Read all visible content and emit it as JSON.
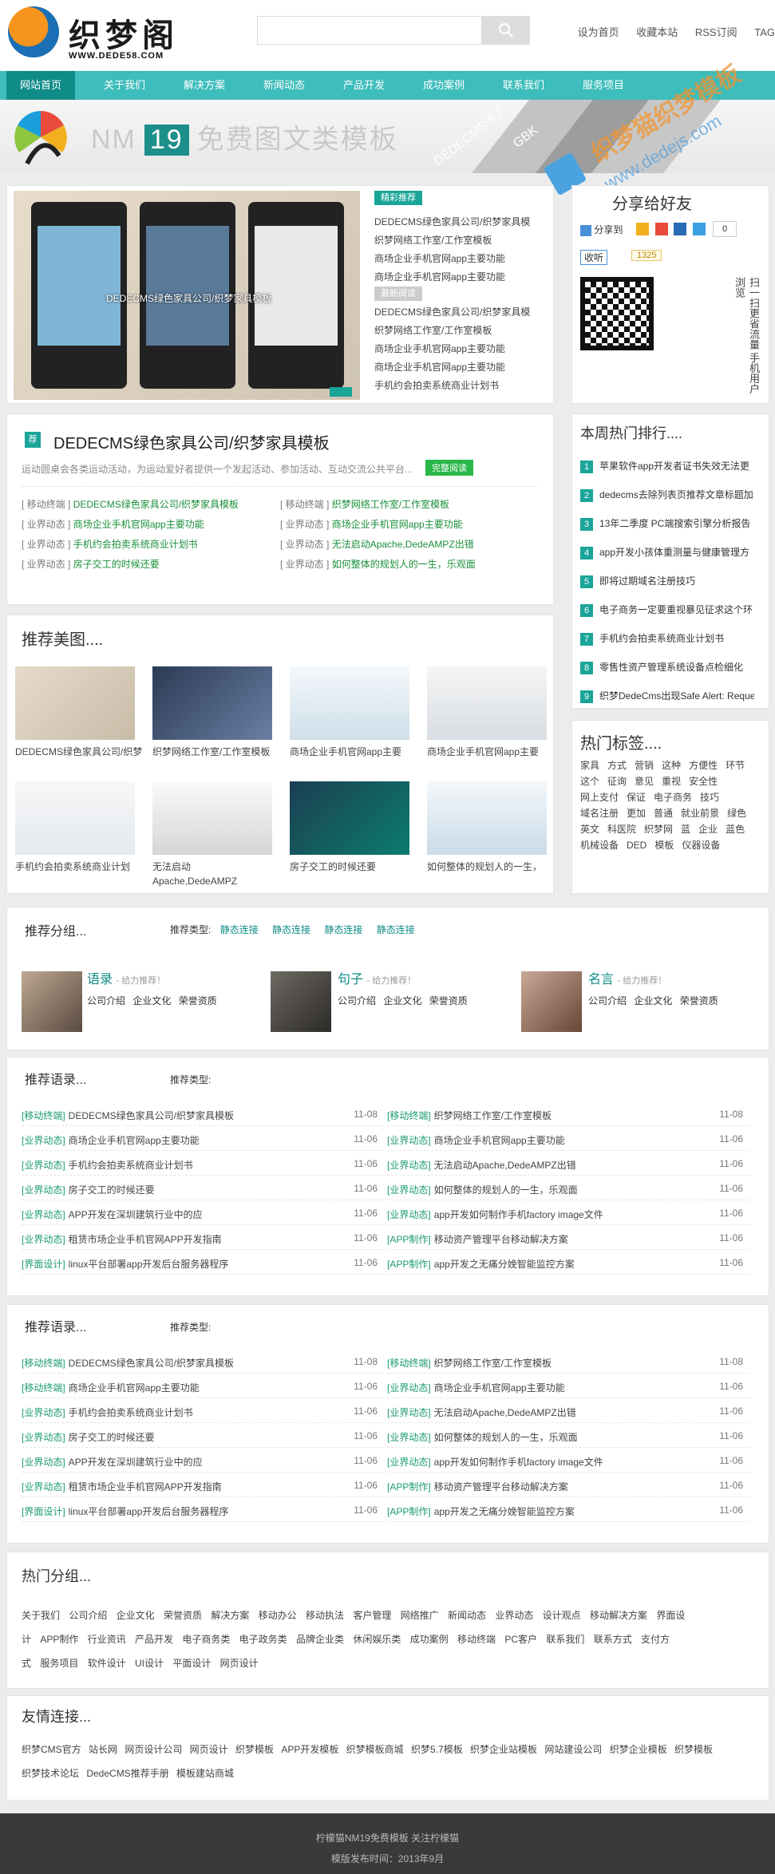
{
  "header": {
    "logo_name": "织梦阁",
    "logo_url": "WWW.DEDE58.COM",
    "search_placeholder": "",
    "links": [
      "设为首页",
      "收藏本站",
      "RSS订阅",
      "TAG"
    ]
  },
  "nav": {
    "items": [
      "网站首页",
      "关于我们",
      "解决方案",
      "新闻动态",
      "产品开发",
      "成功案例",
      "联系我们",
      "服务项目"
    ]
  },
  "banner": {
    "title_prefix": "NM",
    "title_num": "19",
    "title_suffix": "免费图文类模板",
    "ribbon_1": "DEDECMS 5.7",
    "ribbon_2": "GBK"
  },
  "watermark": {
    "text": "织梦猫织梦模板",
    "url": "www.dedejs.com"
  },
  "slider": {
    "caption": "DEDECMS绿色家具公司/织梦家具模板"
  },
  "featured": {
    "tag1": "精彩推荐",
    "list1": [
      "DEDECMS绿色家具公司/织梦家具模",
      "织梦网络工作室/工作室模板",
      "商场企业手机官网app主要功能",
      "商场企业手机官网app主要功能"
    ],
    "tag2": "最新阅读",
    "list2": [
      "DEDECMS绿色家具公司/织梦家具模",
      "织梦网络工作室/工作室模板",
      "商场企业手机官网app主要功能",
      "商场企业手机官网app主要功能",
      "手机约会拍卖系统商业计划书"
    ]
  },
  "share": {
    "title": "分享给好友",
    "share_label": "分享到",
    "count": "0",
    "listen_label": "收听",
    "listen_count": "1325",
    "qr_text": "扫一扫更省流量 手机用户浏览"
  },
  "headline": {
    "badge": "荐",
    "title": "DEDECMS绿色家具公司/织梦家具模板",
    "desc": "运动圆桌会各类运动活动，为运动爱好者提供一个发起活动、参加活动、互动交流公共平台...",
    "more": "完整阅读",
    "rows": [
      [
        "[ 移动终端 ]",
        "DEDECMS绿色家具公司/织梦家具模板",
        "[ 移动终端 ]",
        "织梦网络工作室/工作室模板"
      ],
      [
        "[ 业界动态 ]",
        "商场企业手机官网app主要功能",
        "[ 业界动态 ]",
        "商场企业手机官网app主要功能"
      ],
      [
        "[ 业界动态 ]",
        "手机约会拍卖系统商业计划书",
        "[ 业界动态 ]",
        "无法启动Apache,DedeAMPZ出错"
      ],
      [
        "[ 业界动态 ]",
        "房子交工的时候还要",
        "[ 业界动态 ]",
        "如何整体的规划人的一生，乐观面"
      ]
    ]
  },
  "weekly_hot": {
    "title": "本周热门排行....",
    "items": [
      "苹果软件app开发者证书失效无法更",
      "dedecms去除列表页推荐文章标题加",
      "13年二季度 PC端搜索引擎分析报告",
      "app开发小孩体重测量与健康管理方",
      "即将过期域名注册技巧",
      "电子商务一定要重视暴见征求这个环",
      "手机约会拍卖系统商业计划书",
      "零售性资产管理系统设备点检细化",
      "织梦DedeCms出现Safe Alert: Reque"
    ]
  },
  "recommend_images": {
    "title": "推荐美图....",
    "items": [
      "DEDECMS绿色家具公司/织梦",
      "织梦网络工作室/工作室模板",
      "商场企业手机官网app主要",
      "商场企业手机官网app主要",
      "手机约会拍卖系统商业计划",
      "无法启动Apache,DedeAMPZ",
      "房子交工的时候还要",
      "如何整体的规划人的一生，"
    ]
  },
  "hot_tags": {
    "title": "热门标签....",
    "tags": [
      "家具",
      "方式",
      "营销",
      "这种",
      "方便性",
      "环节",
      "这个",
      "征询",
      "意见",
      "重视",
      "安全性",
      "网上支付",
      "保证",
      "电子商务",
      "技巧",
      "域名注册",
      "更加",
      "普通",
      "就业前景",
      "绿色",
      "英文",
      "科医院",
      "织梦网",
      "蓝",
      "企业",
      "蓝色",
      "机械设备",
      "DED",
      "模板",
      "仪器设备"
    ]
  },
  "groups": {
    "title": "推荐分组...",
    "type_label": "推荐类型:",
    "types": [
      "静态连接",
      "静态连接",
      "静态连接",
      "静态连接"
    ],
    "items": [
      {
        "name": "语录",
        "note": "- 给力推荐！",
        "links": [
          "公司介绍",
          "企业文化",
          "荣誉资质"
        ]
      },
      {
        "name": "句子",
        "note": "- 给力推荐！",
        "links": [
          "公司介绍",
          "企业文化",
          "荣誉资质"
        ]
      },
      {
        "name": "名言",
        "note": "- 给力推荐！",
        "links": [
          "公司介绍",
          "企业文化",
          "荣誉资质"
        ]
      }
    ]
  },
  "quotes1": {
    "title": "推荐语录...",
    "type_label": "推荐类型:",
    "left": [
      [
        "[移动终端]",
        "DEDECMS绿色家具公司/织梦家具模板",
        "11-08"
      ],
      [
        "[业界动态]",
        "商场企业手机官网app主要功能",
        "11-06"
      ],
      [
        "[业界动态]",
        "手机约会拍卖系统商业计划书",
        "11-06"
      ],
      [
        "[业界动态]",
        "房子交工的时候还要",
        "11-06"
      ],
      [
        "[业界动态]",
        "APP开发在深圳建筑行业中的应",
        "11-06"
      ],
      [
        "[业界动态]",
        "租赁市场企业手机官网APP开发指南",
        "11-06"
      ],
      [
        "[界面设计]",
        "linux平台部署app开发后台服务器程序",
        "11-06"
      ]
    ],
    "right": [
      [
        "[移动终端]",
        "织梦网络工作室/工作室模板",
        "11-08"
      ],
      [
        "[业界动态]",
        "商场企业手机官网app主要功能",
        "11-06"
      ],
      [
        "[业界动态]",
        "无法启动Apache,DedeAMPZ出错",
        "11-06"
      ],
      [
        "[业界动态]",
        "如何整体的规划人的一生，乐观面",
        "11-06"
      ],
      [
        "[业界动态]",
        "app开发如何制作手机factory image文件",
        "11-06"
      ],
      [
        "[APP制作]",
        "移动资产管理平台移动解决方案",
        "11-06"
      ],
      [
        "[APP制作]",
        "app开发之无痛分娩智能监控方案",
        "11-06"
      ]
    ]
  },
  "quotes2": {
    "title": "推荐语录...",
    "type_label": "推荐类型:",
    "left": [
      [
        "[移动终端]",
        "DEDECMS绿色家具公司/织梦家具模板",
        "11-08"
      ],
      [
        "[移动终端]",
        "商场企业手机官网app主要功能",
        "11-06"
      ],
      [
        "[业界动态]",
        "手机约会拍卖系统商业计划书",
        "11-06"
      ],
      [
        "[业界动态]",
        "房子交工的时候还要",
        "11-06"
      ],
      [
        "[业界动态]",
        "APP开发在深圳建筑行业中的应",
        "11-06"
      ],
      [
        "[业界动态]",
        "租赁市场企业手机官网APP开发指南",
        "11-06"
      ],
      [
        "[界面设计]",
        "linux平台部署app开发后台服务器程序",
        "11-06"
      ]
    ],
    "right": [
      [
        "[移动终端]",
        "织梦网络工作室/工作室模板",
        "11-08"
      ],
      [
        "[业界动态]",
        "商场企业手机官网app主要功能",
        "11-06"
      ],
      [
        "[业界动态]",
        "无法启动Apache,DedeAMPZ出错",
        "11-06"
      ],
      [
        "[业界动态]",
        "如何整体的规划人的一生，乐观面",
        "11-06"
      ],
      [
        "[业界动态]",
        "app开发如何制作手机factory image文件",
        "11-06"
      ],
      [
        "[APP制作]",
        "移动资产管理平台移动解决方案",
        "11-06"
      ],
      [
        "[APP制作]",
        "app开发之无痛分娩智能监控方案",
        "11-06"
      ]
    ]
  },
  "hot_groups": {
    "title": "热门分组...",
    "line1": "关于我们 公司介绍 企业文化 荣誉资质 解决方案 移动办公 移动执法 客户管理 网络推广 新闻动态 业界动态 设计观点 移动解决方案 界面设",
    "line2": "计 APP制作 行业资讯 产品开发 电子商务类 电子政务类 品牌企业类 休闲娱乐类 成功案例 移动终端 PC客户 联系我们 联系方式 支付方",
    "line3": "式 服务项目 软件设计 UI设计 平面设计 网页设计"
  },
  "friends": {
    "title": "友情连接...",
    "line1": "织梦CMS官方 站长网 网页设计公司 网页设计 织梦模板 APP开发模板 织梦模板商城 织梦5.7模板 织梦企业站模板 网站建设公司 织梦企业模板 织梦模板",
    "line2": "织梦技术论坛 DedeCMS推荐手册 模板建站商城"
  },
  "footer": {
    "line1": "柠檬猫NM19免费模板 关注柠檬猫",
    "line2": "模版发布时间：2013年9月"
  }
}
